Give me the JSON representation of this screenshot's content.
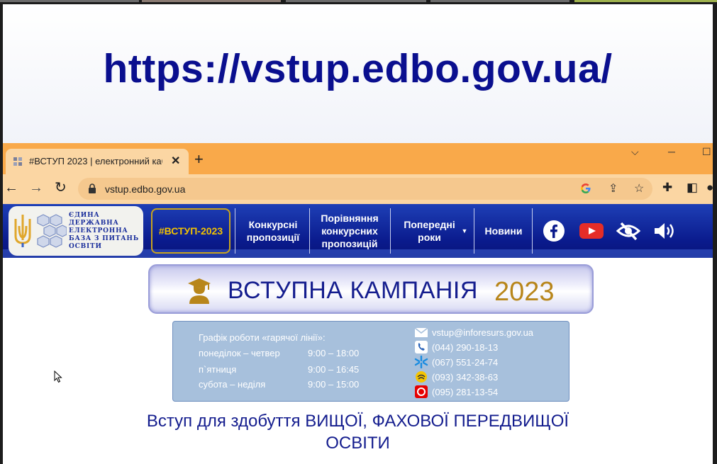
{
  "slide": {
    "url_heading": "https://vstup.edbo.gov.ua/"
  },
  "browser": {
    "tab_title": "#ВСТУП 2023 | електронний каб",
    "new_tab_label": "+",
    "address": "vstup.edbo.gov.ua",
    "icons": [
      "back-arrow-icon",
      "forward-arrow-icon",
      "reload-icon",
      "lock-icon",
      "google-icon",
      "share-icon",
      "star-icon",
      "extensions-icon",
      "sidepanel-icon",
      "profile-icon",
      "minimize-icon",
      "maximize-icon",
      "chevron-down-icon"
    ]
  },
  "site": {
    "logo_lines": [
      "ЄДИНА",
      "ДЕРЖАВНА",
      "ЕЛЕКТРОННА",
      "БАЗА З ПИТАНЬ",
      "ОСВІТИ"
    ],
    "nav": [
      {
        "label": "#ВСТУП-2023"
      },
      {
        "label": "Конкурсні пропозиції"
      },
      {
        "label": "Порівняння конкурсних пропозицій"
      },
      {
        "label": "Попередні роки"
      },
      {
        "label": "Новини"
      }
    ],
    "social_icons": [
      "facebook-icon",
      "youtube-icon",
      "accessibility-eye-icon",
      "sound-icon"
    ],
    "colors": {
      "header": "#0a1a8c",
      "accent": "#f2c200",
      "campaign_year": "#b8861b",
      "hotline_bg": "#a7c0dc"
    }
  },
  "banner": {
    "title": "ВСТУПНА КАМПАНІЯ",
    "year": "2023"
  },
  "hotline": {
    "title": "Графік роботи «гарячої лінії»:",
    "schedule": [
      {
        "days": "понеділок – четвер",
        "time": "9:00 – 18:00"
      },
      {
        "days": "п`ятниця",
        "time": "9:00 – 16:45"
      },
      {
        "days": "субота – неділя",
        "time": "9:00 – 15:00"
      }
    ],
    "contacts": [
      {
        "icon": "envelope-icon",
        "text": "vstup@inforesurs.gov.ua"
      },
      {
        "icon": "phone-icon",
        "text": "(044) 290-18-13"
      },
      {
        "icon": "kyivstar-icon",
        "text": "(067) 551-24-74"
      },
      {
        "icon": "lifecell-icon",
        "text": "(093) 342-38-63"
      },
      {
        "icon": "vodafone-icon",
        "text": "(095) 281-13-54"
      }
    ]
  },
  "entry": {
    "line1": "Вступ для здобуття ВИЩОЇ, ФАХОВОЇ ПЕРЕДВИЩОЇ",
    "line2": "ОСВІТИ"
  }
}
